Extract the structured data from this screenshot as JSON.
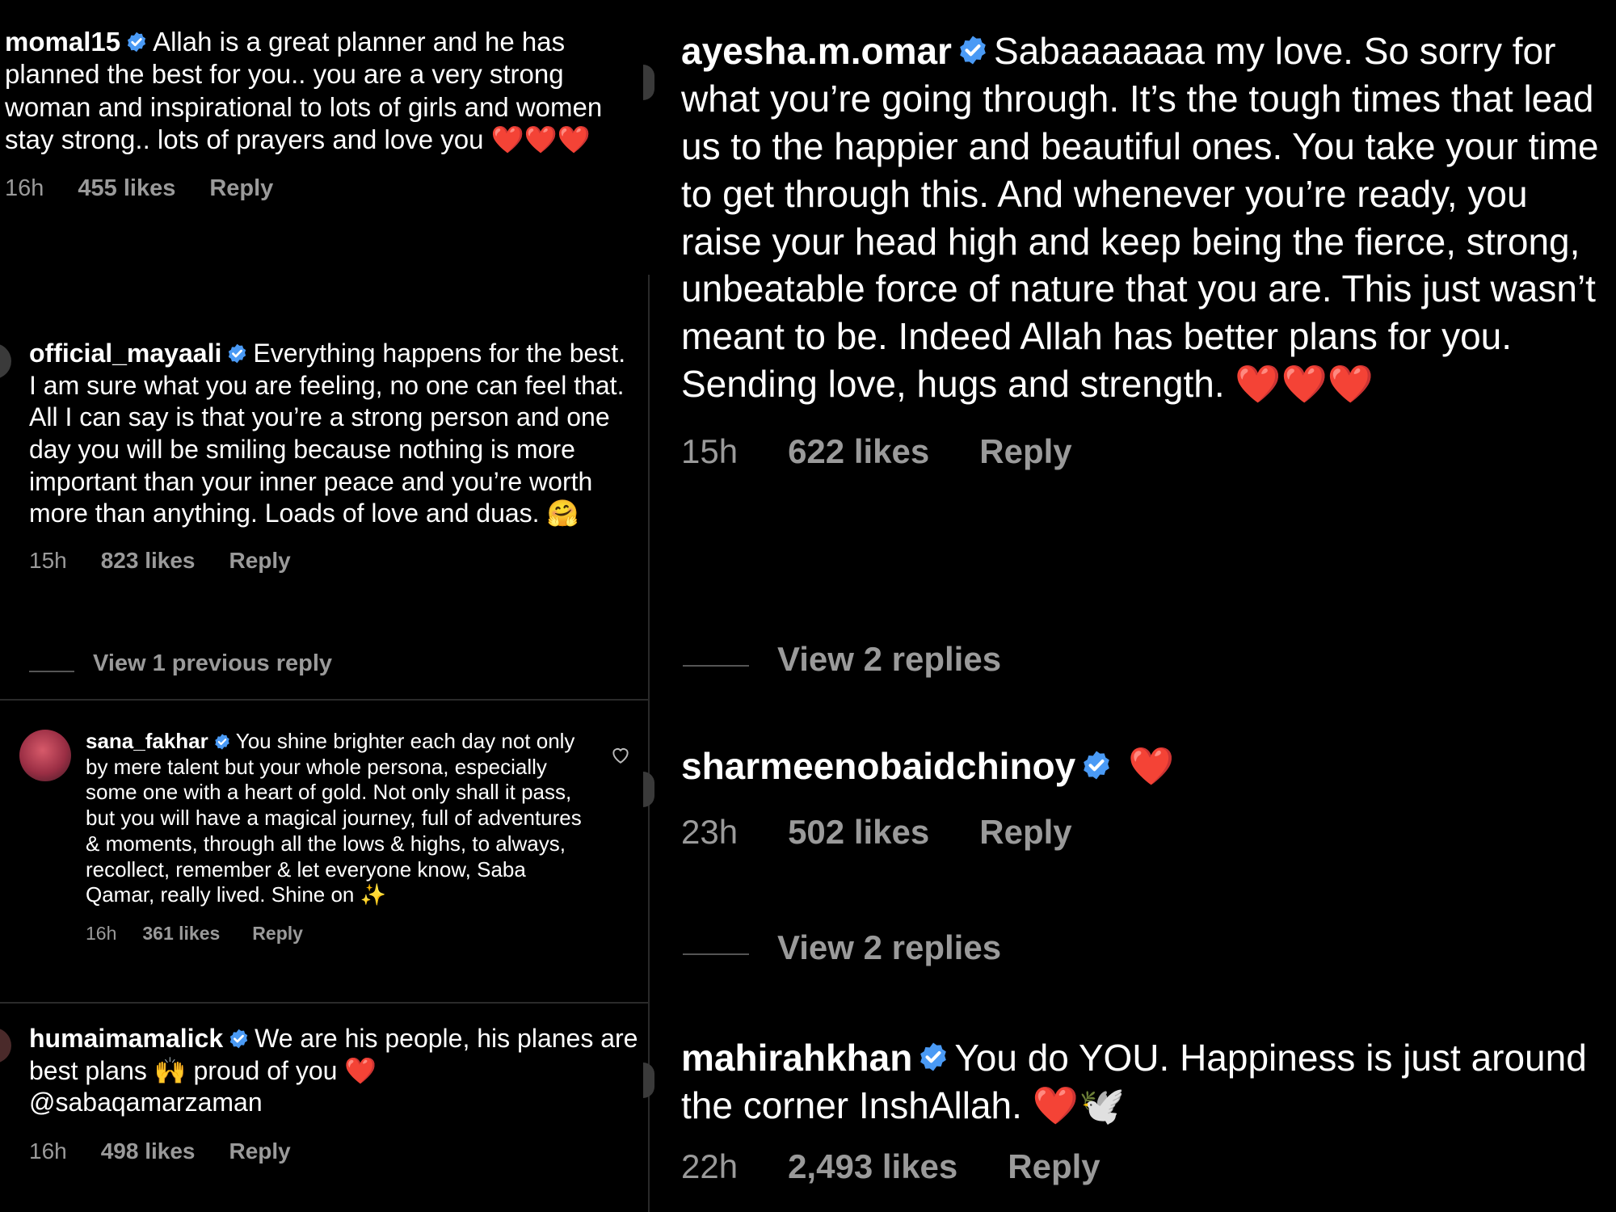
{
  "verified_color": "#4a9af5",
  "heart_color": "#e0242c",
  "left": {
    "momal": {
      "username": "momal15",
      "text": "Allah is a great planner and he has planned the best for you.. you are a very strong woman and inspirational to lots of girls and women stay strong.. lots of prayers and love you",
      "emoji": "❤️❤️❤️",
      "time": "16h",
      "likes": "455 likes",
      "reply": "Reply"
    },
    "maya": {
      "username": "official_mayaali",
      "text": "Everything happens for the best. I am sure what you are feeling, no one can feel that. All I can say is that you’re a strong person and one day you will be smiling because nothing is more important than your inner peace and you’re worth more than anything. Loads of love and duas.",
      "emoji": "🤗",
      "time": "15h",
      "likes": "823 likes",
      "reply": "Reply",
      "view_replies": "View 1 previous reply"
    },
    "sana": {
      "username": "sana_fakhar",
      "text": "You shine brighter each day not only by mere talent but your whole persona, especially some one with a heart of gold. Not only shall it pass, but you will have a magical journey, full of adventures & moments, through all the lows & highs, to always, recollect, remember & let everyone know, Saba Qamar, really lived. Shine on",
      "emoji": "✨",
      "time": "16h",
      "likes": "361 likes",
      "reply": "Reply"
    },
    "humaima": {
      "username": "humaimamalick",
      "text_before": "We are his people, his planes are best plans",
      "emoji1": "🙌",
      "text_after": "proud of you",
      "emoji2": "❤️",
      "mention": "@sabaqamarzaman",
      "time": "16h",
      "likes": "498 likes",
      "reply": "Reply"
    }
  },
  "right": {
    "ayesha": {
      "username": "ayesha.m.omar",
      "text": "Sabaaaaaaa my love. So sorry for what you’re going through. It’s the tough times that lead us to the happier and beautiful ones. You take your time to get through this. And whenever you’re ready, you raise your head high and keep being the fierce, strong, unbeatable force of nature that you are. This just wasn’t meant to be. Indeed Allah has better plans for you. Sending love, hugs and strength.",
      "emoji": "❤️❤️❤️",
      "time": "15h",
      "likes": "622 likes",
      "reply": "Reply",
      "view_replies": "View 2 replies"
    },
    "sharmeen": {
      "username": "sharmeenobaidchinoy",
      "emoji": "❤️",
      "time": "23h",
      "likes": "502 likes",
      "reply": "Reply",
      "view_replies": "View 2 replies"
    },
    "mahira": {
      "username": "mahirahkhan",
      "text": "You do YOU. Happiness is just around the corner InshAllah.",
      "emoji": "❤️🕊️",
      "time": "22h",
      "likes": "2,493 likes",
      "reply": "Reply"
    }
  }
}
